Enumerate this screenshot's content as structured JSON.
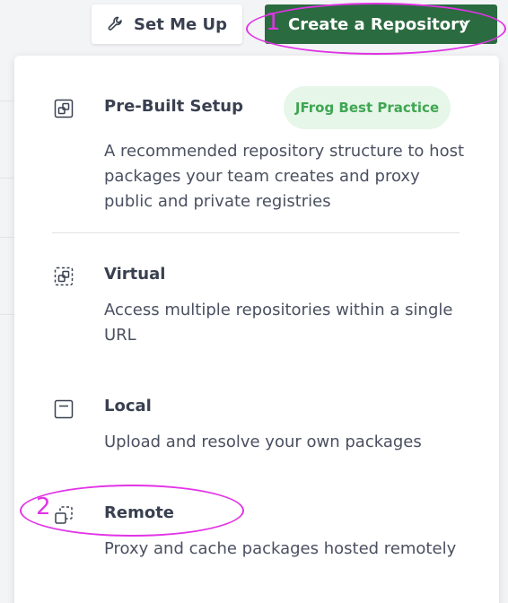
{
  "header": {
    "set_me_up_label": "Set Me Up",
    "create_repo_label": "Create a Repository"
  },
  "annotations": {
    "step1": "1",
    "step2": "2"
  },
  "menu": {
    "items": [
      {
        "title": "Pre-Built Setup",
        "badge": "JFrog Best Practice",
        "description": "A recommended repository structure to host packages your team creates and proxy public and private registries"
      },
      {
        "title": "Virtual",
        "description": "Access multiple repositories within a single URL"
      },
      {
        "title": "Local",
        "description": "Upload and resolve your own packages"
      },
      {
        "title": "Remote",
        "description": "Proxy and cache packages hosted remotely"
      }
    ]
  },
  "colors": {
    "primary_button": "#2b6b40",
    "badge_bg": "#e6f6e9",
    "badge_text": "#3fa652",
    "annotation": "#e233e6"
  }
}
